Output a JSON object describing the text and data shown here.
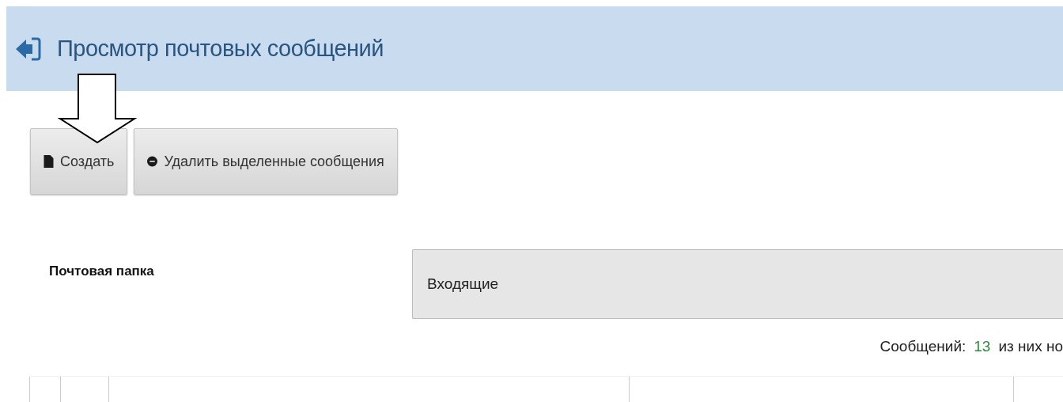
{
  "header": {
    "title": "Просмотр почтовых сообщений"
  },
  "toolbar": [
    {
      "kind": "create",
      "label": "Создать"
    },
    {
      "kind": "delete",
      "label": "Удалить выделенные сообщения"
    }
  ],
  "folder": {
    "label": "Почтовая папка",
    "value": "Входящие"
  },
  "counter": {
    "label": "Сообщений:",
    "count": "13",
    "rest": "из них но"
  }
}
